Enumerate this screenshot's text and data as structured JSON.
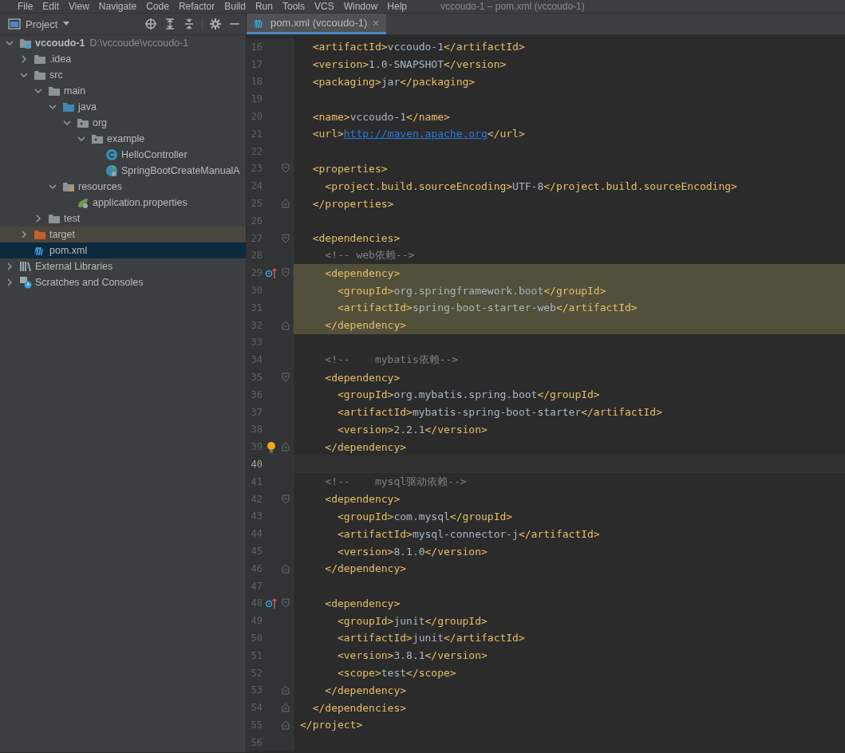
{
  "menu_bar": {
    "items": [
      "File",
      "Edit",
      "View",
      "Navigate",
      "Code",
      "Refactor",
      "Build",
      "Run",
      "Tools",
      "VCS",
      "Window",
      "Help"
    ],
    "title": "vccoudo-1 – pom.xml (vccoudo-1)"
  },
  "project_panel": {
    "title": "Project",
    "tools": [
      {
        "kind": "locate"
      },
      {
        "kind": "expand"
      },
      {
        "kind": "collapse"
      },
      {
        "kind": "gear"
      },
      {
        "kind": "hide"
      }
    ],
    "tree": [
      {
        "label": "vccoudo-1",
        "hint": "D:\\vccoude\\vccoudo-1",
        "kind": "module",
        "expanded": true,
        "selected": false,
        "children": [
          {
            "label": ".idea",
            "kind": "folder",
            "expanded": false,
            "selected": false
          },
          {
            "label": "src",
            "kind": "folder",
            "expanded": true,
            "selected": false,
            "children": [
              {
                "label": "main",
                "kind": "folder",
                "expanded": true,
                "selected": false,
                "children": [
                  {
                    "label": "java",
                    "kind": "source",
                    "expanded": true,
                    "selected": false,
                    "children": [
                      {
                        "label": "org",
                        "kind": "package",
                        "expanded": true,
                        "selected": false,
                        "children": [
                          {
                            "label": "example",
                            "kind": "package",
                            "expanded": true,
                            "selected": false,
                            "children": [
                              {
                                "label": "HelloController",
                                "kind": "class",
                                "selected": false
                              },
                              {
                                "label": "SpringBootCreateManualA",
                                "kind": "spring-class",
                                "selected": false
                              }
                            ]
                          }
                        ]
                      }
                    ]
                  },
                  {
                    "label": "resources",
                    "kind": "resources",
                    "expanded": true,
                    "selected": false,
                    "children": [
                      {
                        "label": "application.properties",
                        "kind": "properties",
                        "selected": false
                      }
                    ]
                  }
                ]
              },
              {
                "label": "test",
                "kind": "folder",
                "expanded": false,
                "selected": false
              }
            ]
          },
          {
            "label": "target",
            "kind": "excluded",
            "expanded": false,
            "selected": false,
            "excluded": true
          },
          {
            "label": "pom.xml",
            "kind": "maven",
            "selected": true
          }
        ]
      },
      {
        "label": "External Libraries",
        "kind": "libraries",
        "expanded": false,
        "selected": false
      },
      {
        "label": "Scratches and Consoles",
        "kind": "scratches",
        "expanded": false,
        "selected": false
      }
    ]
  },
  "editor": {
    "tabs": [
      {
        "label": "pom.xml (vccoudo-1)",
        "kind": "maven",
        "selected": true
      }
    ],
    "lines": [
      {
        "number": "16",
        "selected": false,
        "current": false,
        "code": [
          {
            "kind": "tag",
            "text": "  <artifactId>"
          },
          {
            "kind": "text",
            "text": "vccoudo-1"
          },
          {
            "kind": "tag",
            "text": "</artifactId>"
          }
        ]
      },
      {
        "number": "17",
        "selected": false,
        "current": false,
        "code": [
          {
            "kind": "tag",
            "text": "  <version>"
          },
          {
            "kind": "text",
            "text": "1.0-SNAPSHOT"
          },
          {
            "kind": "tag",
            "text": "</version>"
          }
        ]
      },
      {
        "number": "18",
        "selected": false,
        "current": false,
        "code": [
          {
            "kind": "tag",
            "text": "  <packaging>"
          },
          {
            "kind": "text",
            "text": "jar"
          },
          {
            "kind": "tag",
            "text": "</packaging>"
          }
        ]
      },
      {
        "number": "19",
        "selected": false,
        "current": false
      },
      {
        "number": "20",
        "selected": false,
        "current": false,
        "code": [
          {
            "kind": "tag",
            "text": "  <name>"
          },
          {
            "kind": "text",
            "text": "vccoudo-1"
          },
          {
            "kind": "tag",
            "text": "</name>"
          }
        ]
      },
      {
        "number": "21",
        "selected": false,
        "current": false,
        "code": [
          {
            "kind": "tag",
            "text": "  <url>"
          },
          {
            "kind": "link",
            "text": "http://maven.apache.org"
          },
          {
            "kind": "tag",
            "text": "</url>"
          }
        ]
      },
      {
        "number": "22",
        "selected": false,
        "current": false
      },
      {
        "number": "23",
        "selected": false,
        "current": false,
        "gutter": [
          {
            "kind": "fold-start"
          }
        ],
        "code": [
          {
            "kind": "tag",
            "text": "  <properties>"
          }
        ]
      },
      {
        "number": "24",
        "selected": false,
        "current": false,
        "code": [
          {
            "kind": "tag",
            "text": "    <project.build.sourceEncoding>"
          },
          {
            "kind": "text",
            "text": "UTF-8"
          },
          {
            "kind": "tag",
            "text": "</project.build.sourceEncoding>"
          }
        ]
      },
      {
        "number": "25",
        "selected": false,
        "current": false,
        "gutter": [
          {
            "kind": "fold-end"
          }
        ],
        "code": [
          {
            "kind": "tag",
            "text": "  </properties>"
          }
        ]
      },
      {
        "number": "26",
        "selected": false,
        "current": false
      },
      {
        "number": "27",
        "selected": false,
        "current": false,
        "gutter": [
          {
            "kind": "fold-start"
          }
        ],
        "code": [
          {
            "kind": "tag",
            "text": "  <dependencies>"
          }
        ]
      },
      {
        "number": "28",
        "selected": false,
        "current": false,
        "code": [
          {
            "kind": "comment",
            "text": "    <!-- web依赖-->"
          }
        ]
      },
      {
        "number": "29",
        "selected": true,
        "current": false,
        "gutter": [
          {
            "kind": "override"
          },
          {
            "kind": "fold-start"
          }
        ],
        "code": [
          {
            "kind": "tag",
            "text": "    <dependency>"
          }
        ]
      },
      {
        "number": "30",
        "selected": true,
        "current": false,
        "code": [
          {
            "kind": "tag",
            "text": "      <groupId>"
          },
          {
            "kind": "text",
            "text": "org.springframework.boot"
          },
          {
            "kind": "tag",
            "text": "</groupId>"
          }
        ]
      },
      {
        "number": "31",
        "selected": true,
        "current": false,
        "code": [
          {
            "kind": "tag",
            "text": "      <artifactId>"
          },
          {
            "kind": "text",
            "text": "spring-boot-starter-web"
          },
          {
            "kind": "tag",
            "text": "</artifactId>"
          }
        ]
      },
      {
        "number": "32",
        "selected": true,
        "current": false,
        "gutter": [
          {
            "kind": "fold-end"
          }
        ],
        "code": [
          {
            "kind": "tag",
            "text": "    </dependency>"
          }
        ]
      },
      {
        "number": "33",
        "selected": false,
        "current": false
      },
      {
        "number": "34",
        "selected": false,
        "current": false,
        "code": [
          {
            "kind": "comment",
            "text": "    <!--    mybatis依赖-->"
          }
        ]
      },
      {
        "number": "35",
        "selected": false,
        "current": false,
        "gutter": [
          {
            "kind": "fold-start"
          }
        ],
        "code": [
          {
            "kind": "tag",
            "text": "    <dependency>"
          }
        ]
      },
      {
        "number": "36",
        "selected": false,
        "current": false,
        "code": [
          {
            "kind": "tag",
            "text": "      <groupId>"
          },
          {
            "kind": "text",
            "text": "org.mybatis.spring.boot"
          },
          {
            "kind": "tag",
            "text": "</groupId>"
          }
        ]
      },
      {
        "number": "37",
        "selected": false,
        "current": false,
        "code": [
          {
            "kind": "tag",
            "text": "      <artifactId>"
          },
          {
            "kind": "text",
            "text": "mybatis-spring-boot-starter"
          },
          {
            "kind": "tag",
            "text": "</artifactId>"
          }
        ]
      },
      {
        "number": "38",
        "selected": false,
        "current": false,
        "code": [
          {
            "kind": "tag",
            "text": "      <version>"
          },
          {
            "kind": "text",
            "text": "2.2.1"
          },
          {
            "kind": "tag",
            "text": "</version>"
          }
        ]
      },
      {
        "number": "39",
        "selected": false,
        "current": false,
        "gutter": [
          {
            "kind": "bulb"
          },
          {
            "kind": "fold-end"
          }
        ],
        "code": [
          {
            "kind": "tag",
            "text": "    </dependency>"
          }
        ]
      },
      {
        "number": "40",
        "selected": false,
        "current": true
      },
      {
        "number": "41",
        "selected": false,
        "current": false,
        "code": [
          {
            "kind": "comment",
            "text": "    <!--    mysql驱动依赖-->"
          }
        ]
      },
      {
        "number": "42",
        "selected": false,
        "current": false,
        "gutter": [
          {
            "kind": "fold-start"
          }
        ],
        "code": [
          {
            "kind": "tag",
            "text": "    <dependency>"
          }
        ]
      },
      {
        "number": "43",
        "selected": false,
        "current": false,
        "code": [
          {
            "kind": "tag",
            "text": "      <groupId>"
          },
          {
            "kind": "text",
            "text": "com.mysql"
          },
          {
            "kind": "tag",
            "text": "</groupId>"
          }
        ]
      },
      {
        "number": "44",
        "selected": false,
        "current": false,
        "code": [
          {
            "kind": "tag",
            "text": "      <artifactId>"
          },
          {
            "kind": "text",
            "text": "mysql-connector-j"
          },
          {
            "kind": "tag",
            "text": "</artifactId>"
          }
        ]
      },
      {
        "number": "45",
        "selected": false,
        "current": false,
        "code": [
          {
            "kind": "tag",
            "text": "      <version>"
          },
          {
            "kind": "text",
            "text": "8.1.0"
          },
          {
            "kind": "tag",
            "text": "</version>"
          }
        ]
      },
      {
        "number": "46",
        "selected": false,
        "current": false,
        "gutter": [
          {
            "kind": "fold-end"
          }
        ],
        "code": [
          {
            "kind": "tag",
            "text": "    </dependency>"
          }
        ]
      },
      {
        "number": "47",
        "selected": false,
        "current": false
      },
      {
        "number": "48",
        "selected": false,
        "current": false,
        "gutter": [
          {
            "kind": "override"
          },
          {
            "kind": "fold-start"
          }
        ],
        "code": [
          {
            "kind": "tag",
            "text": "    <dependency>"
          }
        ]
      },
      {
        "number": "49",
        "selected": false,
        "current": false,
        "code": [
          {
            "kind": "tag",
            "text": "      <groupId>"
          },
          {
            "kind": "text",
            "text": "junit"
          },
          {
            "kind": "tag",
            "text": "</groupId>"
          }
        ]
      },
      {
        "number": "50",
        "selected": false,
        "current": false,
        "code": [
          {
            "kind": "tag",
            "text": "      <artifactId>"
          },
          {
            "kind": "text",
            "text": "junit"
          },
          {
            "kind": "tag",
            "text": "</artifactId>"
          }
        ]
      },
      {
        "number": "51",
        "selected": false,
        "current": false,
        "code": [
          {
            "kind": "tag",
            "text": "      <version>"
          },
          {
            "kind": "text",
            "text": "3.8.1"
          },
          {
            "kind": "tag",
            "text": "</version>"
          }
        ]
      },
      {
        "number": "52",
        "selected": false,
        "current": false,
        "code": [
          {
            "kind": "tag",
            "text": "      <scope>"
          },
          {
            "kind": "text",
            "text": "test"
          },
          {
            "kind": "tag",
            "text": "</scope>"
          }
        ]
      },
      {
        "number": "53",
        "selected": false,
        "current": false,
        "gutter": [
          {
            "kind": "fold-end"
          }
        ],
        "code": [
          {
            "kind": "tag",
            "text": "    </dependency>"
          }
        ]
      },
      {
        "number": "54",
        "selected": false,
        "current": false,
        "gutter": [
          {
            "kind": "fold-end"
          }
        ],
        "code": [
          {
            "kind": "tag",
            "text": "  </dependencies>"
          }
        ]
      },
      {
        "number": "55",
        "selected": false,
        "current": false,
        "gutter": [
          {
            "kind": "fold-end"
          }
        ],
        "code": [
          {
            "kind": "tag",
            "text": "</project>"
          }
        ]
      },
      {
        "number": "56",
        "selected": false,
        "current": false
      }
    ]
  }
}
